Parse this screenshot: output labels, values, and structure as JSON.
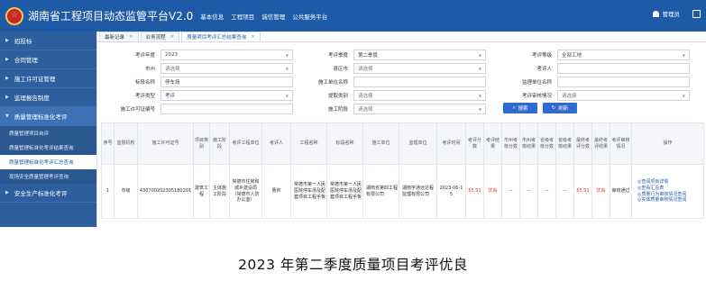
{
  "header": {
    "emblem": "☆",
    "app_title": "湖南省工程项目动态监管平台V2.0",
    "nav": [
      "基本信息",
      "工程项目",
      "诚信管理",
      "公共服务平台"
    ],
    "user_label": "管理员"
  },
  "sidebar": {
    "items": [
      {
        "label": "招投标"
      },
      {
        "label": "合同管理"
      },
      {
        "label": "施工许可证管理"
      },
      {
        "label": "监理报告制度"
      },
      {
        "label": "质量管理标准化考评"
      }
    ],
    "subitems": [
      {
        "label": "质量管理项目自评"
      },
      {
        "label": "质量管理标准化考评结果查询"
      },
      {
        "label": "质量管理标准化考评汇总查询"
      },
      {
        "label": "现场安全质量管理考评查询"
      }
    ],
    "last_item": {
      "label": "安全生产标准化考评"
    }
  },
  "tabs": [
    {
      "label": "最新记录"
    },
    {
      "label": "业务流程"
    },
    {
      "label": "质量项目考评汇总结果查询"
    }
  ],
  "form": {
    "year": {
      "label": "考评年度",
      "value": "2023"
    },
    "season": {
      "label": "考评季度",
      "value": "第二季度"
    },
    "level": {
      "label": "考评等级",
      "value": "全部工地"
    },
    "city": {
      "label": "市州",
      "placeholder": "请选择"
    },
    "county": {
      "label": "县区市",
      "placeholder": "请选择"
    },
    "evaluator": {
      "label": "考评人",
      "value": ""
    },
    "bid_name": {
      "label": "标段名称",
      "value": "停车场"
    },
    "builder": {
      "label": "施工单位名称",
      "value": ""
    },
    "supervisor": {
      "label": "监理单位名称",
      "value": ""
    },
    "eval_type": {
      "label": "考评类型",
      "value": "考评"
    },
    "problem_type": {
      "label": "提取类别",
      "placeholder": "请选择"
    },
    "review": {
      "label": "考评审核情况",
      "placeholder": "请选择"
    },
    "permit": {
      "label": "施工许可证编号",
      "value": ""
    },
    "stage": {
      "label": "施工阶段",
      "placeholder": "请选择"
    },
    "search_button": "搜索",
    "refresh_button": "刷新"
  },
  "table": {
    "headers": [
      "序号",
      "监督机构",
      "施工许可证号",
      "项目类别",
      "施工阶段",
      "考评工程单位",
      "考评人",
      "工程名称",
      "标段名称",
      "施工单位",
      "监理单位",
      "考评时间",
      "考评分数",
      "考评结果",
      "市州考核分数",
      "市州考核结果",
      "省级考核分数",
      "省级考核结果",
      "最终考评分数",
      "最终考评结果",
      "考评审核情况",
      "操作"
    ],
    "rows": [
      {
        "index": "1",
        "org": "市级",
        "permit": "430700202305180201",
        "category": "建筑工程",
        "stage": "主体施工阶段",
        "eval_unit": "常德市住房和城乡建设局（常德市人防办公室）",
        "evaluator": "曹帅",
        "project": "常德市第一人民医院停车场及配套项目工程手板",
        "section": "常德市第一人民医院停车场及配套项目工程手板",
        "builder": "湖南省第四工程有限公司",
        "supervisor": "湖南宇通远达程监理有限公司",
        "time": "2023-06-15",
        "score": "85.91",
        "result": "优良",
        "city_score": "--",
        "city_result": "--",
        "prov_score": "--",
        "prov_result": "--",
        "final_score": "85.91",
        "final_result": "优良",
        "review": "审核通过",
        "ops": [
          "◎查阅项目详情",
          "◎查看汇总表",
          "◎质量行为审核情况查阅",
          "◎实体质量审核情况查阅"
        ]
      }
    ]
  },
  "caption": "2023 年第二季度质量项目考评优良",
  "colors": {
    "primary": "#1f5aa6",
    "sidebar": "#2d5f9e",
    "button": "#2e6ad1",
    "alert": "#e53935"
  }
}
